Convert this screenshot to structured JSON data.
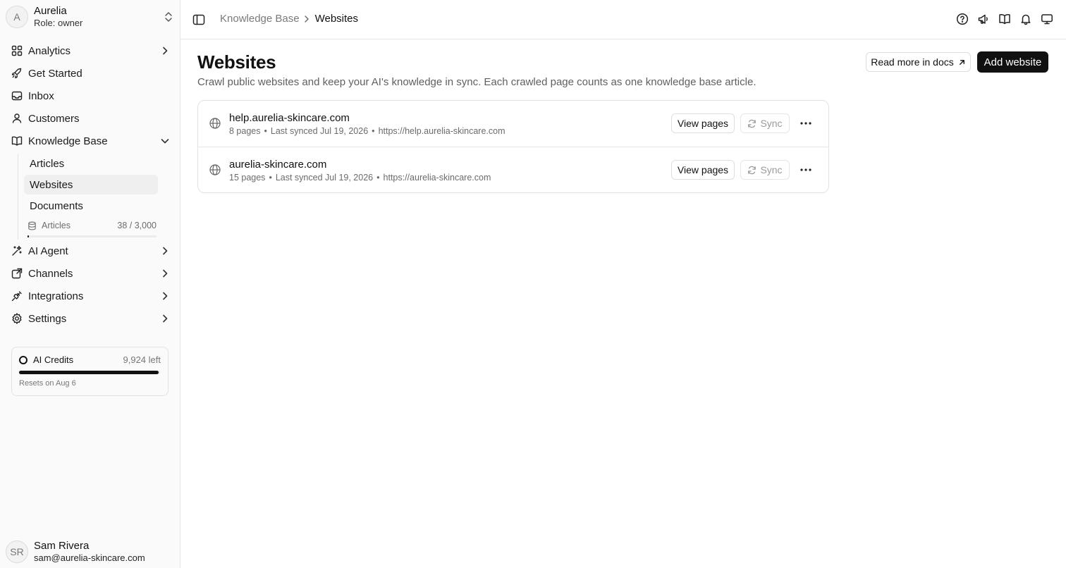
{
  "workspace": {
    "initial": "A",
    "name": "Aurelia",
    "role": "Role: owner"
  },
  "nav": {
    "analytics": "Analytics",
    "get_started": "Get Started",
    "inbox": "Inbox",
    "customers": "Customers",
    "knowledge_base": "Knowledge Base",
    "kb_sub": {
      "articles": "Articles",
      "websites": "Websites",
      "documents": "Documents"
    },
    "usage": {
      "label": "Articles",
      "value": "38 / 3,000",
      "fraction": 0.0127
    },
    "ai_agent": "AI Agent",
    "channels": "Channels",
    "integrations": "Integrations",
    "settings": "Settings"
  },
  "credits": {
    "label": "AI Credits",
    "left": "9,924 left",
    "fraction": 0.99,
    "reset": "Resets on Aug 6"
  },
  "user": {
    "initials": "SR",
    "name": "Sam Rivera",
    "email": "sam@aurelia-skincare.com"
  },
  "breadcrumb": {
    "parent": "Knowledge Base",
    "current": "Websites"
  },
  "page": {
    "title": "Websites",
    "subtitle": "Crawl public websites and keep your AI's knowledge in sync. Each crawled page counts as one knowledge base article.",
    "docs_button": "Read more in docs",
    "add_button": "Add website"
  },
  "websites": [
    {
      "domain": "help.aurelia-skincare.com",
      "pages": "8 pages",
      "synced": "Last synced Jul 19, 2026",
      "url": "https://help.aurelia-skincare.com",
      "view": "View pages",
      "sync": "Sync"
    },
    {
      "domain": "aurelia-skincare.com",
      "pages": "15 pages",
      "synced": "Last synced Jul 19, 2026",
      "url": "https://aurelia-skincare.com",
      "view": "View pages",
      "sync": "Sync"
    }
  ],
  "meta_separator": "•",
  "icons": [
    "chevrons-up-down-icon",
    "grid-icon",
    "rocket-icon",
    "inbox-icon",
    "user-icon",
    "book-icon",
    "chevron-right-icon",
    "chevron-down-icon",
    "database-icon",
    "sparkles-icon",
    "share-icon",
    "plug-icon",
    "gear-icon",
    "sidebar-toggle-icon",
    "help-icon",
    "megaphone-icon",
    "book-open-icon",
    "bell-icon",
    "monitor-icon",
    "globe-icon",
    "refresh-icon",
    "more-icon",
    "arrow-up-right-icon"
  ]
}
